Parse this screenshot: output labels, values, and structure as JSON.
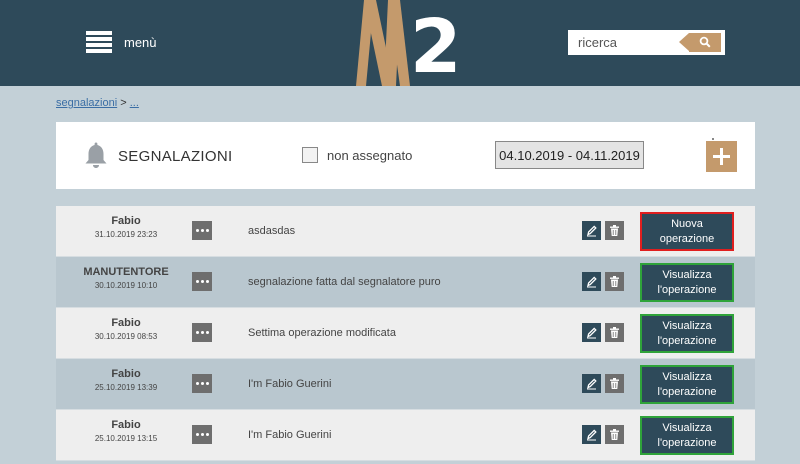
{
  "header": {
    "menu_label": "menù",
    "logo_digit": "2",
    "search_placeholder": "ricerca"
  },
  "breadcrumb": {
    "link": "segnalazioni",
    "separator": " > ",
    "current": "..."
  },
  "panel": {
    "title": "SEGNALAZIONI",
    "checkbox_label": "non assegnato",
    "date_range": "04.10.2019 - 04.11.2019"
  },
  "rows": [
    {
      "name": "Fabio",
      "date": "31.10.2019 23:23",
      "desc": "asdasdas",
      "action": "Nuova operazione"
    },
    {
      "name": "MANUTENTORE",
      "date": "30.10.2019 10:10",
      "desc": "segnalazione fatta dal segnalatore puro",
      "action": "Visualizza l'operazione"
    },
    {
      "name": "Fabio",
      "date": "30.10.2019 08:53",
      "desc": "Settima operazione modificata",
      "action": "Visualizza l'operazione"
    },
    {
      "name": "Fabio",
      "date": "25.10.2019 13:39",
      "desc": "I'm Fabio Guerini",
      "action": "Visualizza l'operazione"
    },
    {
      "name": "Fabio",
      "date": "25.10.2019 13:15",
      "desc": "I'm Fabio Guerini",
      "action": "Visualizza l'operazione"
    }
  ],
  "colors": {
    "header_bg": "#2e4a5a",
    "accent": "#c49a6c",
    "new_operation_border": "#e01f1f",
    "view_operation_border": "#2fa33a"
  }
}
